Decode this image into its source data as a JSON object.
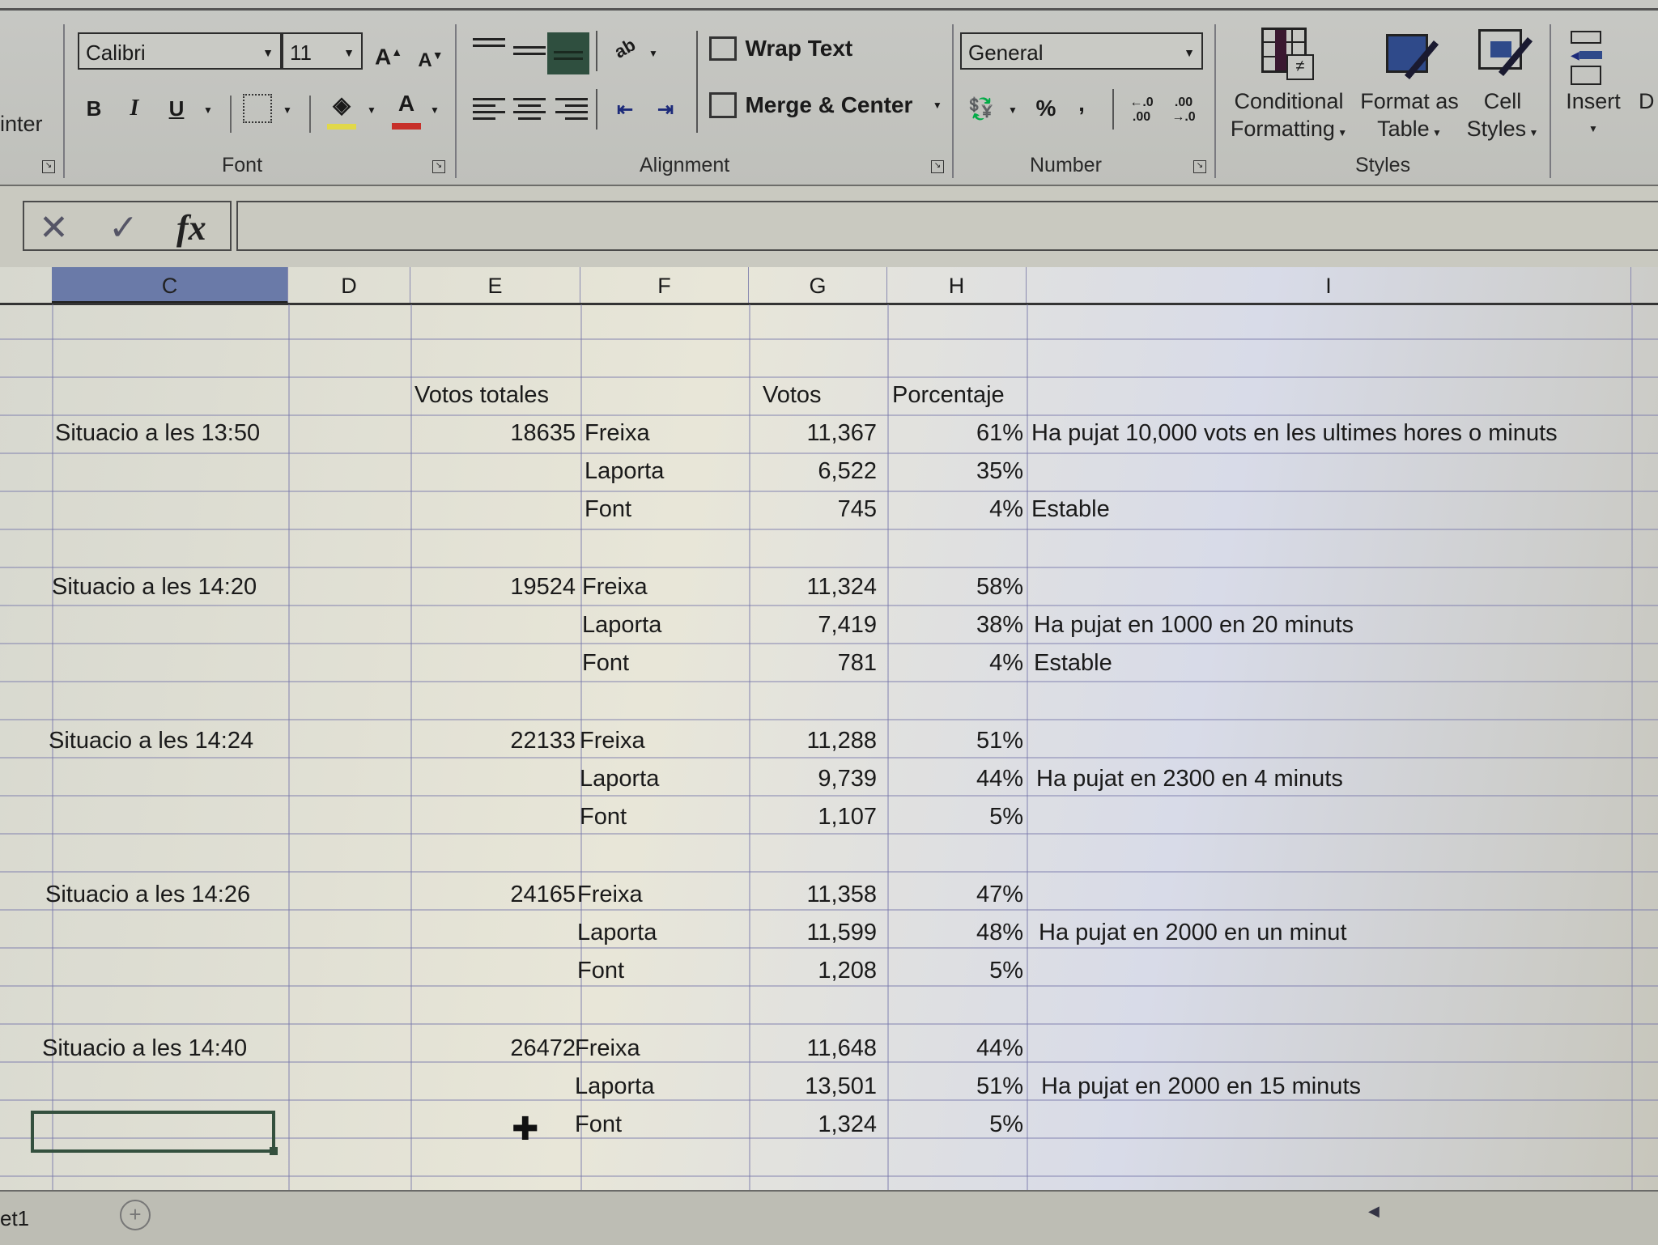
{
  "ribbon": {
    "clipboard_partial_label": "inter",
    "font": {
      "group_label": "Font",
      "font_name": "Calibri",
      "font_size": "11",
      "bold": "B",
      "italic": "I",
      "underline": "U",
      "increase_font": "A",
      "decrease_font": "A",
      "font_color_letter": "A",
      "fill_color": "#e1d84a",
      "font_color": "#c7302a"
    },
    "alignment": {
      "group_label": "Alignment",
      "wrap_text": "Wrap Text",
      "merge_center": "Merge & Center"
    },
    "number": {
      "group_label": "Number",
      "format": "General",
      "percent": "%",
      "comma": ",",
      "increase_decimal": "←.0 .00",
      "decrease_decimal": ".00 →.0"
    },
    "styles": {
      "group_label": "Styles",
      "conditional_formatting": [
        "Conditional",
        "Formatting"
      ],
      "format_as_table": [
        "Format as",
        "Table"
      ],
      "cell_styles": [
        "Cell",
        "Styles"
      ]
    },
    "cells": {
      "insert": "Insert",
      "delete_partial": "D"
    }
  },
  "formula_bar": {
    "cancel": "✕",
    "enter": "✓",
    "fx": "fx",
    "value": ""
  },
  "columns": [
    {
      "letter": "C",
      "selected": true
    },
    {
      "letter": "D",
      "selected": false
    },
    {
      "letter": "E",
      "selected": false
    },
    {
      "letter": "F",
      "selected": false
    },
    {
      "letter": "G",
      "selected": false
    },
    {
      "letter": "H",
      "selected": false
    },
    {
      "letter": "I",
      "selected": false
    }
  ],
  "headers": {
    "total_votes": "Votos totales",
    "votes": "Votos",
    "percentage": "Porcentaje"
  },
  "snapshots": [
    {
      "label": "Situacio a les 13:50",
      "total": "18635",
      "rows": [
        {
          "candidate": "Freixa",
          "votes": "11,367",
          "pct": "61%",
          "note": "Ha pujat 10,000 vots en les ultimes hores o minuts"
        },
        {
          "candidate": "Laporta",
          "votes": "6,522",
          "pct": "35%",
          "note": ""
        },
        {
          "candidate": "Font",
          "votes": "745",
          "pct": "4%",
          "note": "Estable"
        }
      ]
    },
    {
      "label": "Situacio a les 14:20",
      "total": "19524",
      "rows": [
        {
          "candidate": "Freixa",
          "votes": "11,324",
          "pct": "58%",
          "note": ""
        },
        {
          "candidate": "Laporta",
          "votes": "7,419",
          "pct": "38%",
          "note": "Ha pujat en 1000 en 20 minuts"
        },
        {
          "candidate": "Font",
          "votes": "781",
          "pct": "4%",
          "note": "Estable"
        }
      ]
    },
    {
      "label": "Situacio a les 14:24",
      "total": "22133",
      "rows": [
        {
          "candidate": "Freixa",
          "votes": "11,288",
          "pct": "51%",
          "note": ""
        },
        {
          "candidate": "Laporta",
          "votes": "9,739",
          "pct": "44%",
          "note": "Ha pujat en 2300 en 4 minuts"
        },
        {
          "candidate": "Font",
          "votes": "1,107",
          "pct": "5%",
          "note": ""
        }
      ]
    },
    {
      "label": "Situacio a les 14:26",
      "total": "24165",
      "rows": [
        {
          "candidate": "Freixa",
          "votes": "11,358",
          "pct": "47%",
          "note": ""
        },
        {
          "candidate": "Laporta",
          "votes": "11,599",
          "pct": "48%",
          "note": "Ha pujat en 2000 en un minut"
        },
        {
          "candidate": "Font",
          "votes": "1,208",
          "pct": "5%",
          "note": ""
        }
      ]
    },
    {
      "label": "Situacio a les 14:40",
      "total": "26472",
      "rows": [
        {
          "candidate": "Freixa",
          "votes": "11,648",
          "pct": "44%",
          "note": ""
        },
        {
          "candidate": "Laporta",
          "votes": "13,501",
          "pct": "51%",
          "note": "Ha pujat en 2000 en 15 minuts"
        },
        {
          "candidate": "Font",
          "votes": "1,324",
          "pct": "5%",
          "note": ""
        }
      ]
    }
  ],
  "sheet_tab_partial": "et1",
  "colors": {
    "selected_column_header": "#6a7aa8",
    "center_align_active": "#2f4f3f"
  }
}
